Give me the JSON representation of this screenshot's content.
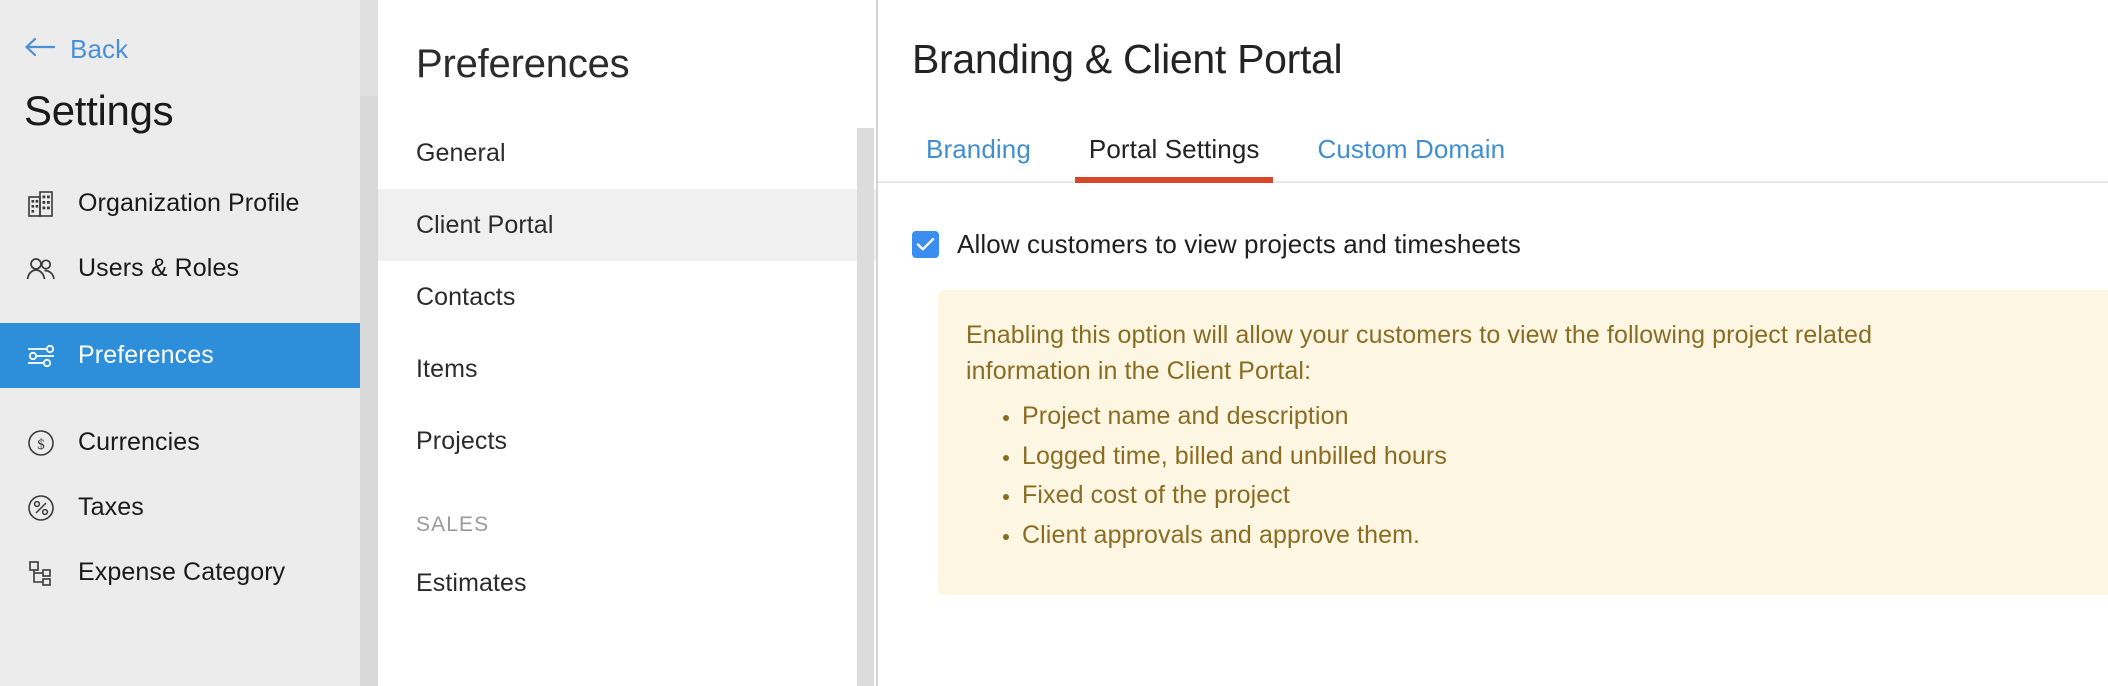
{
  "sidebar": {
    "back_label": "Back",
    "back_icon": "arrow-left-icon",
    "title": "Settings",
    "items": [
      {
        "label": "Organization Profile",
        "icon": "building-icon",
        "active": false
      },
      {
        "label": "Users & Roles",
        "icon": "users-icon",
        "active": false
      },
      {
        "label": "Preferences",
        "icon": "sliders-icon",
        "active": true
      },
      {
        "label": "Currencies",
        "icon": "dollar-circle-icon",
        "active": false
      },
      {
        "label": "Taxes",
        "icon": "percent-circle-icon",
        "active": false
      },
      {
        "label": "Expense Category",
        "icon": "hierarchy-icon",
        "active": false
      }
    ],
    "active_color": "#2d8ed9",
    "background_color": "#ececec"
  },
  "preferences": {
    "title": "Preferences",
    "items": [
      {
        "label": "General",
        "selected": false
      },
      {
        "label": "Client Portal",
        "selected": true
      },
      {
        "label": "Contacts",
        "selected": false
      },
      {
        "label": "Items",
        "selected": false
      },
      {
        "label": "Projects",
        "selected": false
      }
    ],
    "section_label": "SALES",
    "section_items": [
      {
        "label": "Estimates",
        "selected": false
      }
    ],
    "selected_color": "#f0f0f0"
  },
  "main": {
    "title": "Branding & Client Portal",
    "tabs": [
      {
        "label": "Branding",
        "active": false
      },
      {
        "label": "Portal Settings",
        "active": true
      },
      {
        "label": "Custom Domain",
        "active": false
      }
    ],
    "active_tab_underline_color": "#d9472b",
    "tab_link_color": "#3f8fd0",
    "checkbox": {
      "label": "Allow customers to view projects and timesheets",
      "checked": true,
      "checked_color": "#3b8ef0"
    },
    "info_box": {
      "paragraph": "Enabling this option will allow your customers to view the following project related information in the Client Portal:",
      "bullets": [
        "Project name and description",
        "Logged time, billed and unbilled hours",
        "Fixed cost of the project",
        "Client approvals and approve them."
      ],
      "background_color": "#fdf6e3",
      "text_color": "#8a6d23"
    }
  }
}
